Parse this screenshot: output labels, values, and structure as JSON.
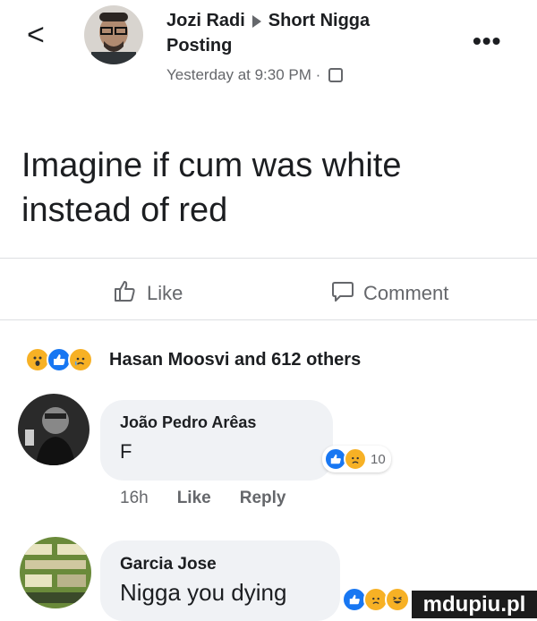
{
  "header": {
    "back_symbol": "<",
    "author": "Jozi Radi",
    "group": "Short Nigga",
    "group_line2": "Posting",
    "timestamp": "Yesterday at 9:30 PM ·",
    "more_symbol": "•••"
  },
  "post": {
    "text_line1": "Imagine if cum was white",
    "text_line2": "instead of red"
  },
  "actions": {
    "like_label": "Like",
    "comment_label": "Comment"
  },
  "reactions": {
    "summary": "Hasan Moosvi and 612 others",
    "icons": [
      "wow-icon",
      "like-icon",
      "sad-icon"
    ]
  },
  "comments": [
    {
      "name": "João Pedro Arêas",
      "text": "F",
      "reaction_count": "10",
      "time": "16h",
      "like_label": "Like",
      "reply_label": "Reply"
    },
    {
      "name": "Garcia Jose",
      "text": "Nigga you dying"
    }
  ],
  "watermark": "mdupiu.pl",
  "colors": {
    "like_blue": "#1877f2",
    "reaction_yellow": "#f7b125",
    "secondary_text": "#65676b",
    "bubble_bg": "#f0f2f5"
  }
}
